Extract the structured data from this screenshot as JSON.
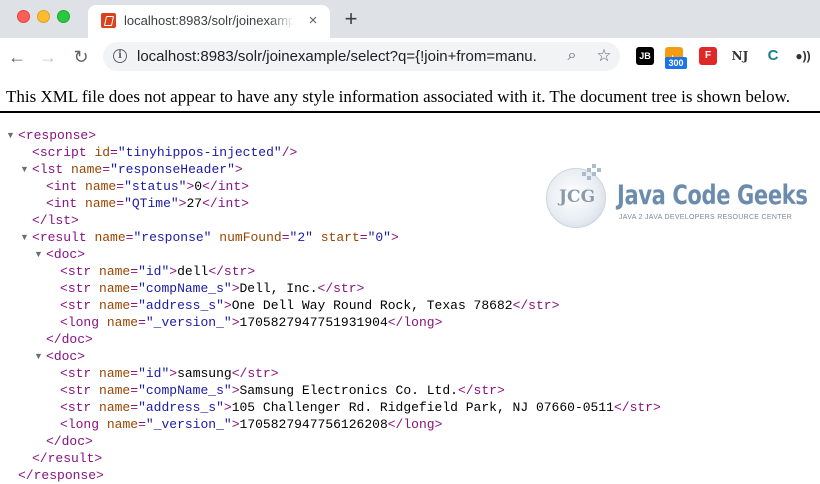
{
  "browser": {
    "tab_title": "localhost:8983/solr/joinexampl",
    "url": "localhost:8983/solr/joinexample/select?q={!join+from=manu...",
    "extensions": {
      "jb_label": "JB",
      "badge_count": "300",
      "nj_label": "NJ"
    }
  },
  "page": {
    "notice": "This XML file does not appear to have any style information associated with it. The document tree is shown below."
  },
  "watermark": {
    "logo_text": "JCG",
    "name": "Java Code Geeks",
    "tagline": "JAVA 2 JAVA DEVELOPERS RESOURCE CENTER"
  },
  "xml": {
    "response_open": "response",
    "script_tag": "script",
    "script_attr": "id",
    "script_val": "\"tinyhippos-injected\"",
    "lst_tag": "lst",
    "lst_attr": "name",
    "lst_val": "\"responseHeader\"",
    "status_attr": "name",
    "status_name": "\"status\"",
    "status_value": "0",
    "qtime_name": "\"QTime\"",
    "qtime_value": "27",
    "result_tag": "result",
    "result_name_attr": "name",
    "result_name_val": "\"response\"",
    "numfound_attr": "numFound",
    "numfound_val": "\"2\"",
    "start_attr": "start",
    "start_val": "\"0\"",
    "doc_tag": "doc",
    "str_tag": "str",
    "long_tag": "long",
    "int_tag": "int",
    "name_attr": "name",
    "docs": [
      {
        "id_name": "\"id\"",
        "id": "dell",
        "comp_name": "\"compName_s\"",
        "comp": "Dell, Inc.",
        "addr_name": "\"address_s\"",
        "addr": "One Dell Way Round Rock, Texas 78682",
        "ver_name": "\"_version_\"",
        "ver": "1705827947751931904"
      },
      {
        "id_name": "\"id\"",
        "id": "samsung",
        "comp_name": "\"compName_s\"",
        "comp": "Samsung Electronics Co. Ltd.",
        "addr_name": "\"address_s\"",
        "addr": "105 Challenger Rd. Ridgefield Park, NJ 07660-0511",
        "ver_name": "\"_version_\"",
        "ver": "1705827947756126208"
      }
    ]
  }
}
